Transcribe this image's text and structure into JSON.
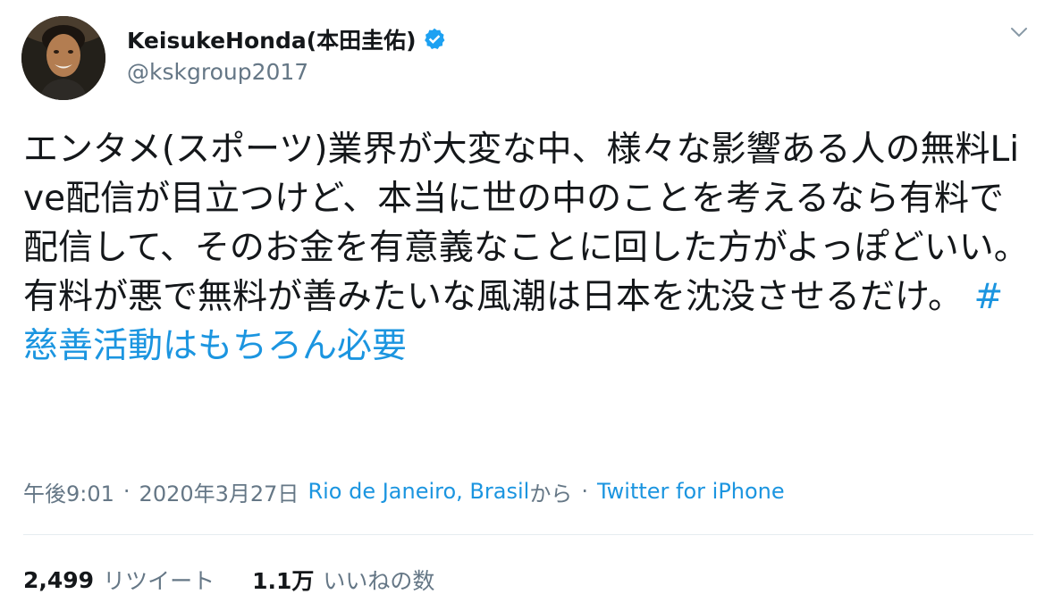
{
  "author": {
    "display_name": "KeisukeHonda(本田圭佑)",
    "handle": "@kskgroup2017",
    "verified": true,
    "avatar_icon": "profile-photo"
  },
  "tweet": {
    "text": "エンタメ(スポーツ)業界が大変な中、様々な影響ある人の無料Live配信が目立つけど、本当に世の中のことを考えるなら有料で配信して、そのお金を有意義なことに回した方がよっぽどいい。有料が悪で無料が善みたいな風潮は日本を沈没させるだけ。 ",
    "hashtag": "#慈善活動はもちろん必要"
  },
  "meta": {
    "time": "午後9:01",
    "separator_1": "·",
    "date": "2020年3月27日",
    "location": "Rio de Janeiro, Brasil",
    "location_suffix": "から",
    "separator_2": "·",
    "source": "Twitter for iPhone"
  },
  "stats": {
    "retweets_count": "2,499",
    "retweets_label": "リツイート",
    "likes_count": "1.1万",
    "likes_label": "いいねの数"
  },
  "colors": {
    "link": "#1b95e0",
    "secondary_text": "#657786",
    "primary_text": "#14171a",
    "verified_badge": "#1da1f2",
    "divider": "#e6ecf0"
  },
  "icons": {
    "verified": "verified-badge-icon",
    "caret": "chevron-down-icon"
  }
}
